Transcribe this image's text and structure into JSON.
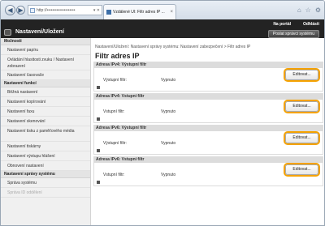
{
  "browser": {
    "url": "http://••••••••••••••••••••",
    "url_controls": "▾ ✕",
    "tab_title": "Vzdálené UI: Filtr adres IP ...",
    "tab_close": "×"
  },
  "header": {
    "portal_link": "Na portál",
    "logout_link": "Odhlásit",
    "title": "Nastavení/Uložení",
    "mail_button": "Poslat správci systému"
  },
  "sidebar": {
    "items": [
      {
        "type": "head",
        "label": "Možnosti"
      },
      {
        "type": "item",
        "label": "Nastavení papíru"
      },
      {
        "type": "tall",
        "label": "Ovládání hlasitosti zvuku / Nastavení zobrazení"
      },
      {
        "type": "item",
        "label": "Nastavení časovače"
      },
      {
        "type": "head",
        "label": "Nastavení funkcí"
      },
      {
        "type": "item",
        "label": "Běžná nastavení"
      },
      {
        "type": "item",
        "label": "Nastavení kopírování"
      },
      {
        "type": "item",
        "label": "Nastavení faxu"
      },
      {
        "type": "item",
        "label": "Nastavení skenování"
      },
      {
        "type": "tall",
        "label": "Nastavení tisku z paměťového média"
      },
      {
        "type": "item",
        "label": "Nastavení tiskárny"
      },
      {
        "type": "item",
        "label": "Nastavení výstupu hlášení"
      },
      {
        "type": "item",
        "label": "Obnovení nastavení"
      },
      {
        "type": "head",
        "label": "Nastavení správy systému"
      },
      {
        "type": "item",
        "label": "Správa systému"
      },
      {
        "type": "dim",
        "label": "Správa ID oddělení"
      }
    ]
  },
  "main": {
    "breadcrumb": "Nastavení/Uložení: Nastavení správy systému: Nastavení zabezpečení > Filtr adres IP",
    "title": "Filtr adres IP",
    "panels": [
      {
        "heading": "Adresa IPv4: Výstupní filtr",
        "row_label": "Výstupní filtr:",
        "row_value": "Vypnuto",
        "button": "Editovat..."
      },
      {
        "heading": "Adresa IPv4: Vstupní filtr",
        "row_label": "Vstupní filtr:",
        "row_value": "Vypnuto",
        "button": "Editovat..."
      },
      {
        "heading": "Adresa IPv6: Výstupní filtr",
        "row_label": "Výstupní filtr:",
        "row_value": "Vypnuto",
        "button": "Editovat..."
      },
      {
        "heading": "Adresa IPv6: Vstupní filtr",
        "row_label": "Vstupní filtr:",
        "row_value": "Vypnuto",
        "button": "Editovat..."
      }
    ]
  },
  "icons": {
    "back": "◀",
    "forward": "▶",
    "window_controls": [
      "⌂",
      "☆",
      "⚙"
    ]
  },
  "colors": {
    "header_bg": "#232323",
    "highlight": "#f5a200",
    "panel_head_bg": "#dcdcdc"
  }
}
